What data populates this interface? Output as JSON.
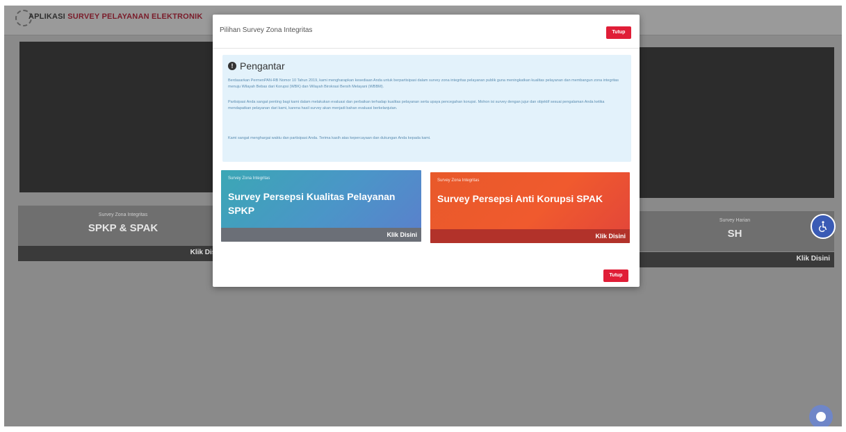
{
  "app": {
    "title_part1": "APLIKASI ",
    "title_part2": "SURVEY PELAYANAN ELEKTRONIK"
  },
  "background_cards": {
    "left": {
      "subtitle": "Survey Zona Integritas",
      "code": "SPKP & SPAK",
      "link_label": "Klik Disini"
    },
    "right": {
      "subtitle": "Survey Harian",
      "code": "SH",
      "link_label": "Klik Disini"
    }
  },
  "modal": {
    "title": "Pilihan Survey Zona Integritas",
    "close_label_top": "Tutup",
    "close_label_bottom": "Tutup",
    "intro": {
      "heading": "Pengantar",
      "paragraphs": [
        "Berdasarkan PermenPAN-RB Nomor 10 Tahun 2019, kami mengharapkan kesediaan Anda untuk berpartisipasi dalam survey zona integritas pelayanan publik guna meningkatkan kualitas pelayanan dan membangun zona integritas menuju Wilayah Bebas dari Korupsi (WBK) dan Wilayah Birokrasi Bersih Melayani (WBBM).",
        "Partisipasi Anda sangat penting bagi kami dalam melakukan evaluasi dan perbaikan terhadap kualitas pelayanan serta upaya pencegahan korupsi. Mohon isi survey dengan jujur dan objektif sesuai pengalaman Anda ketika mendapatkan pelayanan dari kami, karena hasil survey akan menjadi bahan evaluasi berkelanjutan.",
        "Kami sangat menghargai waktu dan partisipasi Anda. Terima kasih atas kepercayaan dan dukungan Anda kepada kami."
      ]
    },
    "cards": [
      {
        "label": "Survey Zona Integritas",
        "title": "Survey Persepsi Kualitas Pelayanan SPKP",
        "link_label": "Klik Disini"
      },
      {
        "label": "Survey Zona Integritas",
        "title": "Survey Persepsi Anti Korupsi SPAK",
        "link_label": "Klik Disini"
      }
    ]
  },
  "colors": {
    "accent_red": "#e01e37",
    "spkp_card": "#4b95c8",
    "spak_card": "#f05a2e",
    "intro_bg": "#e3f2fb"
  },
  "icons": [
    "logo-icon",
    "info-icon",
    "accessibility-icon",
    "chat-icon"
  ]
}
